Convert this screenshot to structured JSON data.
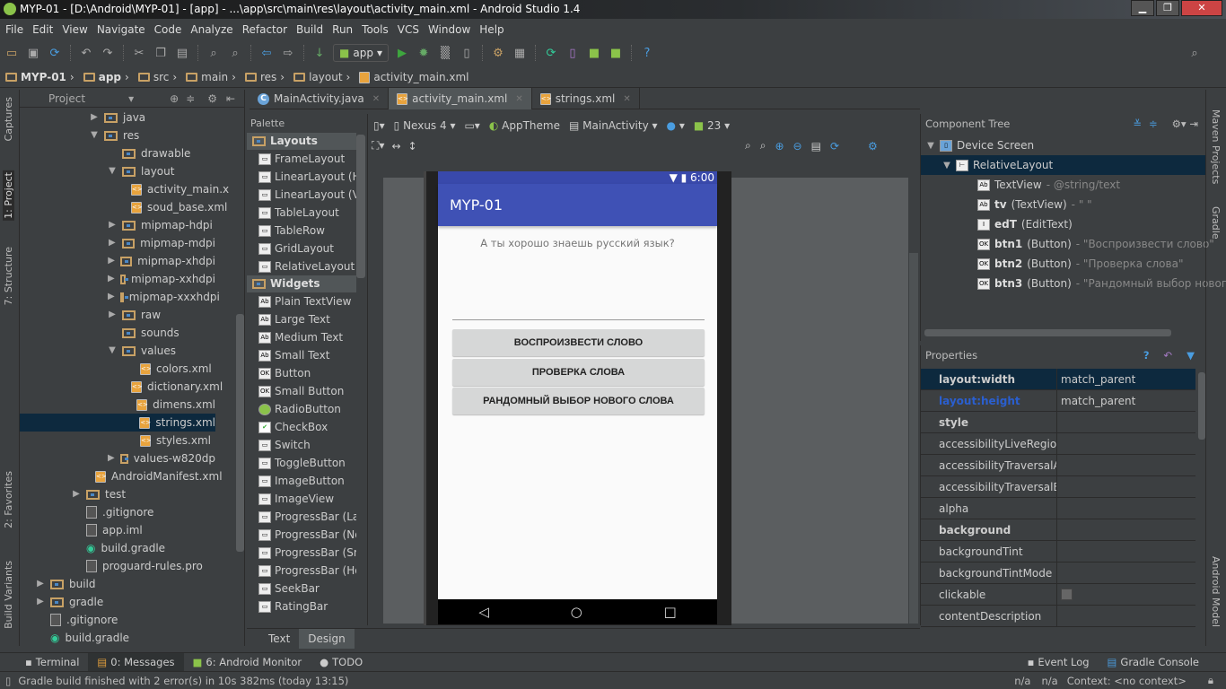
{
  "window": {
    "title": "MYP-01 - [D:\\Android\\MYP-01] - [app] - ...\\app\\src\\main\\res\\layout\\activity_main.xml - Android Studio 1.4",
    "controls": [
      "▁",
      "❐",
      "✕"
    ]
  },
  "menu": [
    "File",
    "Edit",
    "View",
    "Navigate",
    "Code",
    "Analyze",
    "Refactor",
    "Build",
    "Run",
    "Tools",
    "VCS",
    "Window",
    "Help"
  ],
  "toolbar": {
    "run_config": "app",
    "icons": [
      "open-icon",
      "save-icon",
      "sync-icon",
      "undo-icon",
      "redo-icon",
      "cut-icon",
      "copy-icon",
      "paste-icon",
      "find-icon",
      "replace-icon",
      "back-icon",
      "forward-icon",
      "make-icon",
      "run-icon",
      "debug-icon",
      "attach-icon",
      "profile-icon",
      "project-structure-icon",
      "sdk-manager-icon",
      "gradle-sync-icon",
      "avd-manager-icon",
      "android-icon",
      "android-device-icon",
      "help-icon"
    ]
  },
  "breadcrumb": [
    "MYP-01",
    "app",
    "src",
    "main",
    "res",
    "layout",
    "activity_main.xml"
  ],
  "left_stripe": [
    "Captures",
    "1: Project",
    "7: Structure",
    "2: Favorites",
    "Build Variants"
  ],
  "project": {
    "view": "Project",
    "tree": [
      {
        "label": "java",
        "depth": 4,
        "arrow": "▶",
        "kind": "folder"
      },
      {
        "label": "res",
        "depth": 4,
        "arrow": "▼",
        "kind": "folder"
      },
      {
        "label": "drawable",
        "depth": 5,
        "arrow": "",
        "kind": "folder"
      },
      {
        "label": "layout",
        "depth": 5,
        "arrow": "▼",
        "kind": "folder"
      },
      {
        "label": "activity_main.x",
        "depth": 6,
        "arrow": "",
        "kind": "xml"
      },
      {
        "label": "soud_base.xml",
        "depth": 6,
        "arrow": "",
        "kind": "xml"
      },
      {
        "label": "mipmap-hdpi",
        "depth": 5,
        "arrow": "▶",
        "kind": "folder"
      },
      {
        "label": "mipmap-mdpi",
        "depth": 5,
        "arrow": "▶",
        "kind": "folder"
      },
      {
        "label": "mipmap-xhdpi",
        "depth": 5,
        "arrow": "▶",
        "kind": "folder"
      },
      {
        "label": "mipmap-xxhdpi",
        "depth": 5,
        "arrow": "▶",
        "kind": "folder"
      },
      {
        "label": "mipmap-xxxhdpi",
        "depth": 5,
        "arrow": "▶",
        "kind": "folder"
      },
      {
        "label": "raw",
        "depth": 5,
        "arrow": "▶",
        "kind": "folder"
      },
      {
        "label": "sounds",
        "depth": 5,
        "arrow": "",
        "kind": "folder"
      },
      {
        "label": "values",
        "depth": 5,
        "arrow": "▼",
        "kind": "folder"
      },
      {
        "label": "colors.xml",
        "depth": 6,
        "arrow": "",
        "kind": "xml"
      },
      {
        "label": "dictionary.xml",
        "depth": 6,
        "arrow": "",
        "kind": "xml"
      },
      {
        "label": "dimens.xml",
        "depth": 6,
        "arrow": "",
        "kind": "xml"
      },
      {
        "label": "strings.xml",
        "depth": 6,
        "arrow": "",
        "kind": "xml",
        "selected": true
      },
      {
        "label": "styles.xml",
        "depth": 6,
        "arrow": "",
        "kind": "xml"
      },
      {
        "label": "values-w820dp",
        "depth": 5,
        "arrow": "▶",
        "kind": "folder"
      },
      {
        "label": "AndroidManifest.xml",
        "depth": 4,
        "arrow": "",
        "kind": "xml"
      },
      {
        "label": "test",
        "depth": 3,
        "arrow": "▶",
        "kind": "folder"
      },
      {
        "label": ".gitignore",
        "depth": 3,
        "arrow": "",
        "kind": "file"
      },
      {
        "label": "app.iml",
        "depth": 3,
        "arrow": "",
        "kind": "file"
      },
      {
        "label": "build.gradle",
        "depth": 3,
        "arrow": "",
        "kind": "gradle"
      },
      {
        "label": "proguard-rules.pro",
        "depth": 3,
        "arrow": "",
        "kind": "file"
      },
      {
        "label": "build",
        "depth": 1,
        "arrow": "▶",
        "kind": "folder"
      },
      {
        "label": "gradle",
        "depth": 1,
        "arrow": "▶",
        "kind": "folder"
      },
      {
        "label": ".gitignore",
        "depth": 1,
        "arrow": "",
        "kind": "file"
      },
      {
        "label": "build.gradle",
        "depth": 1,
        "arrow": "",
        "kind": "gradle"
      }
    ]
  },
  "editor_tabs": [
    {
      "label": "MainActivity.java",
      "active": false
    },
    {
      "label": "activity_main.xml",
      "active": true
    },
    {
      "label": "strings.xml",
      "active": false
    }
  ],
  "palette": {
    "title": "Palette",
    "sections": [
      {
        "name": "Layouts",
        "items": [
          "FrameLayout",
          "LinearLayout (Ho",
          "LinearLayout (Ver",
          "TableLayout",
          "TableRow",
          "GridLayout",
          "RelativeLayout"
        ]
      },
      {
        "name": "Widgets",
        "items": [
          "Plain TextView",
          "Large Text",
          "Medium Text",
          "Small Text",
          "Button",
          "Small Button",
          "RadioButton",
          "CheckBox",
          "Switch",
          "ToggleButton",
          "ImageButton",
          "ImageView",
          "ProgressBar (Larg",
          "ProgressBar (Nor",
          "ProgressBar (Sma",
          "ProgressBar (Hor",
          "SeekBar",
          "RatingBar"
        ]
      }
    ]
  },
  "design_toolbar": {
    "device": "Nexus 4",
    "theme": "AppTheme",
    "activity": "MainActivity",
    "api": "23"
  },
  "phone": {
    "time": "6:00",
    "app_title": "MYP-01",
    "question": "А ты хорошо знаешь русский язык?",
    "buttons": [
      "ВОСПРОИЗВЕСТИ СЛОВО",
      "ПРОВЕРКА СЛОВА",
      "РАНДОМНЫЙ ВЫБОР НОВОГО СЛОВА"
    ],
    "nav": [
      "◁",
      "○",
      "□"
    ],
    "primary_color": "#3f51b5"
  },
  "editor_mode_tabs": [
    {
      "label": "Text",
      "active": false
    },
    {
      "label": "Design",
      "active": true
    }
  ],
  "component_tree": {
    "title": "Component Tree",
    "rows": [
      {
        "id": "Device Screen",
        "rest": "",
        "detail": "",
        "depth": 0,
        "arrow": "▼"
      },
      {
        "id": "RelativeLayout",
        "rest": "",
        "detail": "",
        "depth": 1,
        "arrow": "▼",
        "selected": true
      },
      {
        "id": "TextView",
        "rest": "",
        "detail": " - @string/text",
        "depth": 2,
        "arrow": ""
      },
      {
        "id": "tv",
        "rest": " (TextView)",
        "detail": " - \" \"",
        "depth": 2,
        "arrow": ""
      },
      {
        "id": "edT",
        "rest": " (EditText)",
        "detail": "",
        "depth": 2,
        "arrow": ""
      },
      {
        "id": "btn1",
        "rest": " (Button)",
        "detail": " - \"Воспроизвести слово\"",
        "depth": 2,
        "arrow": ""
      },
      {
        "id": "btn2",
        "rest": " (Button)",
        "detail": " - \"Проверка слова\"",
        "depth": 2,
        "arrow": ""
      },
      {
        "id": "btn3",
        "rest": " (Button)",
        "detail": " - \"Рандомный выбор нового",
        "depth": 2,
        "arrow": ""
      }
    ]
  },
  "properties": {
    "title": "Properties",
    "rows": [
      {
        "name": "layout:width",
        "value": "match_parent",
        "bold": true,
        "selected": true
      },
      {
        "name": "layout:height",
        "value": "match_parent",
        "bold": true,
        "color": "#2a5fd0"
      },
      {
        "name": "style",
        "value": "",
        "bold": true
      },
      {
        "name": "accessibilityLiveRegion",
        "value": ""
      },
      {
        "name": "accessibilityTraversalAfte",
        "value": ""
      },
      {
        "name": "accessibilityTraversalBefc",
        "value": ""
      },
      {
        "name": "alpha",
        "value": ""
      },
      {
        "name": "background",
        "value": "",
        "bold": true
      },
      {
        "name": "backgroundTint",
        "value": ""
      },
      {
        "name": "backgroundTintMode",
        "value": ""
      },
      {
        "name": "clickable",
        "value": "",
        "checkbox": true
      },
      {
        "name": "contentDescription",
        "value": ""
      }
    ]
  },
  "right_stripe": [
    "Maven Projects",
    "Gradle",
    "Android Model"
  ],
  "tool_windows": [
    {
      "label": "Terminal",
      "active": false
    },
    {
      "label": "0: Messages",
      "active": true
    },
    {
      "label": "6: Android Monitor",
      "active": false
    },
    {
      "label": "TODO",
      "active": false
    }
  ],
  "tool_windows_right": [
    "Event Log",
    "Gradle Console"
  ],
  "status": {
    "message": "Gradle build finished with 2 error(s) in 10s 382ms (today 13:15)",
    "pos1": "n/a",
    "pos2": "n/a",
    "context": "Context: <no context>"
  }
}
